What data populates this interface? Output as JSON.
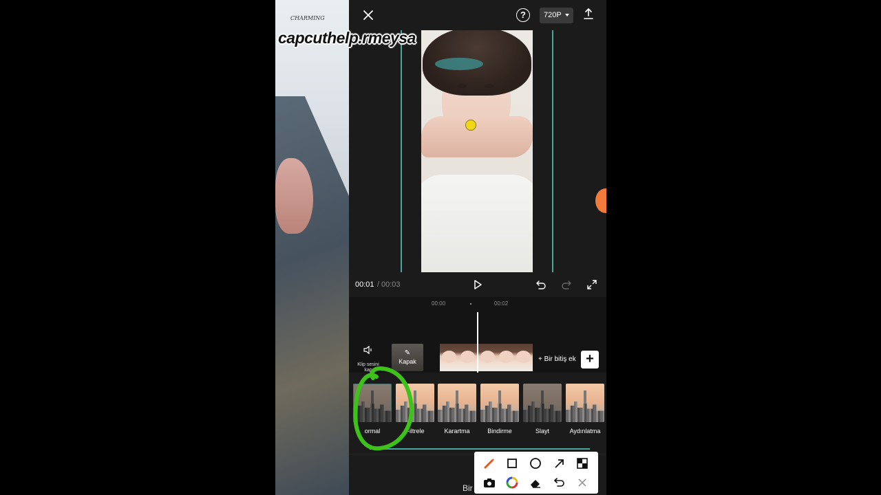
{
  "watermark": "capcuthelp.rmeysa",
  "left_photo": {
    "brand_text": "CHARMING"
  },
  "header": {
    "resolution": "720P",
    "icons": {
      "close": "close-icon",
      "help": "help-icon",
      "export": "export-icon"
    }
  },
  "playback": {
    "current_time": "00:01",
    "separator": "/",
    "total_time": "00:03",
    "icons": {
      "play": "play-icon",
      "undo": "undo-icon",
      "redo": "redo-icon",
      "fullscreen": "fullscreen-icon"
    }
  },
  "timeline": {
    "ruler": [
      "00:00",
      "00:02"
    ],
    "mute_label": "Klip sesini kap",
    "cover_label": "Kapak",
    "add_end_label": "+ Bir bitiş ek",
    "add_clip_label": "+"
  },
  "transitions": {
    "items": [
      {
        "label": "ormal",
        "selected": true
      },
      {
        "label": "Filtrele",
        "selected": false
      },
      {
        "label": "Karartma",
        "selected": false
      },
      {
        "label": "Bindirme",
        "selected": false
      },
      {
        "label": "Slayt",
        "selected": false
      },
      {
        "label": "Aydınlatma",
        "selected": false
      }
    ]
  },
  "bottom": {
    "label": "Bir"
  },
  "draw_toolbar": {
    "tools": [
      "brush-icon",
      "rectangle-icon",
      "circle-icon",
      "arrow-icon",
      "mosaic-icon",
      "camera-icon",
      "color-wheel-icon",
      "eraser-icon",
      "undo-icon",
      "close-icon"
    ]
  },
  "colors": {
    "accent": "#4aa7a0",
    "annotation": "#3ec21a",
    "background": "#1b1b1b"
  }
}
